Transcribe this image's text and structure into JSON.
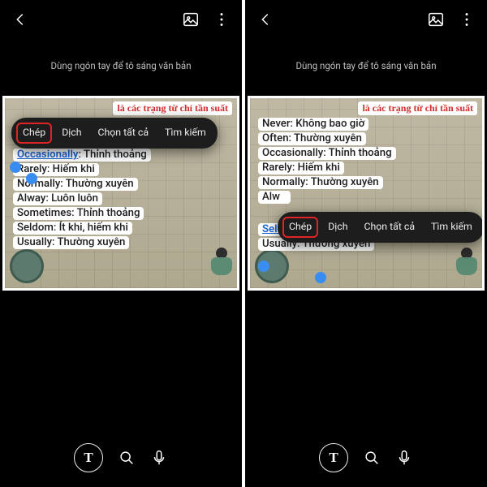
{
  "instruction": "Dùng ngón tay để tô sáng văn bản",
  "heading": "là các trạng từ chỉ tần suất",
  "context_menu": {
    "items": [
      {
        "label": "Chép"
      },
      {
        "label": "Dịch"
      },
      {
        "label": "Chọn tất cả"
      },
      {
        "label": "Tìm kiếm"
      }
    ]
  },
  "bottom": {
    "text_tool_label": "T"
  },
  "left_panel": {
    "highlight_word": "Occasionally",
    "lines": [
      {
        "en": "Occasionally",
        "vi": ": Thỉnh thoảng",
        "highlighted": true
      },
      {
        "en": "Rarely",
        "vi": ": Hiếm khi"
      },
      {
        "en": "Normally",
        "vi": ": Thường xuyên"
      },
      {
        "en": "Alway",
        "vi": ": Luôn luôn"
      },
      {
        "en": "Sometimes",
        "vi": ": Thỉnh thoảng"
      },
      {
        "en": "Seldom",
        "vi": ": Ít khi, hiếm khi"
      },
      {
        "en": "Usually",
        "vi": ": Thường xuyên"
      }
    ]
  },
  "right_panel": {
    "highlight_word": "Seldom",
    "lines": [
      {
        "en": "Never",
        "vi": ": Không bao giờ"
      },
      {
        "en": "Often",
        "vi": ": Thường xuyên"
      },
      {
        "en": "Occasionally",
        "vi": ": Thỉnh thoảng"
      },
      {
        "en": "Rarely",
        "vi": ": Hiếm khi"
      },
      {
        "en": "Normally",
        "vi": ": Thường xuyên"
      },
      {
        "en": "Alw",
        "vi": "",
        "stub": true
      },
      {
        "en": "Seldom",
        "vi": ": Ít khi, hiếm khi",
        "highlighted": true
      },
      {
        "en": "Usually",
        "vi": ": Thường xuyên"
      }
    ]
  }
}
